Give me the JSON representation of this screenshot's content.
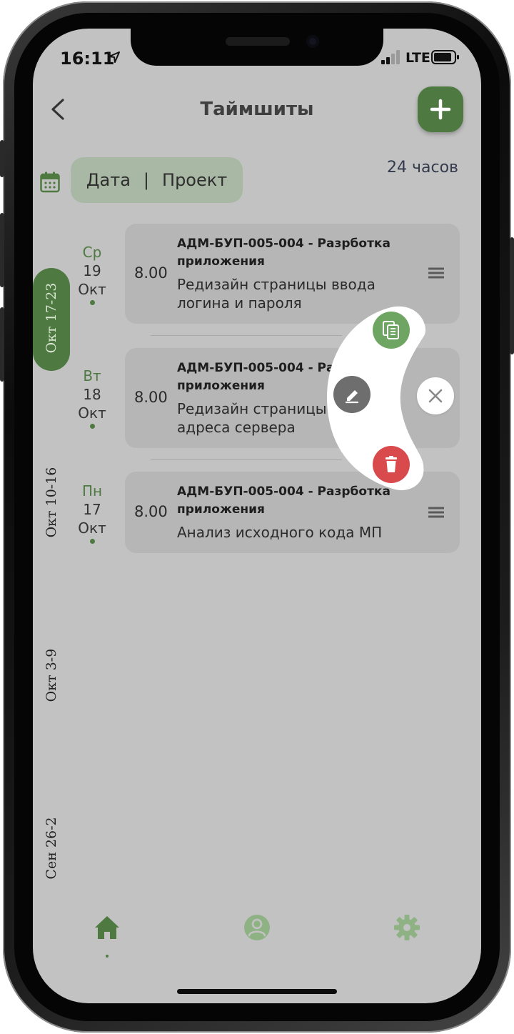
{
  "status_bar": {
    "time": "16:11",
    "network": "LTE"
  },
  "header": {
    "title": "Таймшиты"
  },
  "filter": {
    "date_label": "Дата",
    "separator": "|",
    "project_label": "Проект"
  },
  "total_hours": "24 часов",
  "weeks": [
    {
      "label": "Окт 17-23",
      "active": true
    },
    {
      "label": "Окт 10-16",
      "active": false
    },
    {
      "label": "Окт 3-9",
      "active": false
    },
    {
      "label": "Сен 26-2",
      "active": false
    }
  ],
  "entries": [
    {
      "weekday": "Ср",
      "day": "19",
      "month": "Окт",
      "hours": "8.00",
      "project": "АДМ-БУП-005-004 - Разрботка приложения",
      "description": "Редизайн страницы ввода логина и пароля"
    },
    {
      "weekday": "Вт",
      "day": "18",
      "month": "Окт",
      "hours": "8.00",
      "project": "АДМ-БУП-005-004 - Разрботка приложения",
      "description": "Редизайн страницы ввода адреса сервера"
    },
    {
      "weekday": "Пн",
      "day": "17",
      "month": "Окт",
      "hours": "8.00",
      "project": "АДМ-БУП-005-004 - Разрботка приложения",
      "description": "Анализ исходного кода МП"
    }
  ],
  "context_menu": {
    "actions": [
      "copy-icon",
      "edit-icon",
      "trash-icon",
      "close-icon"
    ]
  },
  "tab_bar": {
    "items": [
      "home-icon",
      "profile-icon",
      "settings-icon"
    ],
    "active": "home-icon"
  },
  "colors": {
    "accent": "#4e7a41",
    "screen_bg": "#c2c2c2",
    "card_bg": "#b6b6b6",
    "delete": "#d94a4d",
    "copy": "#6fa562"
  }
}
